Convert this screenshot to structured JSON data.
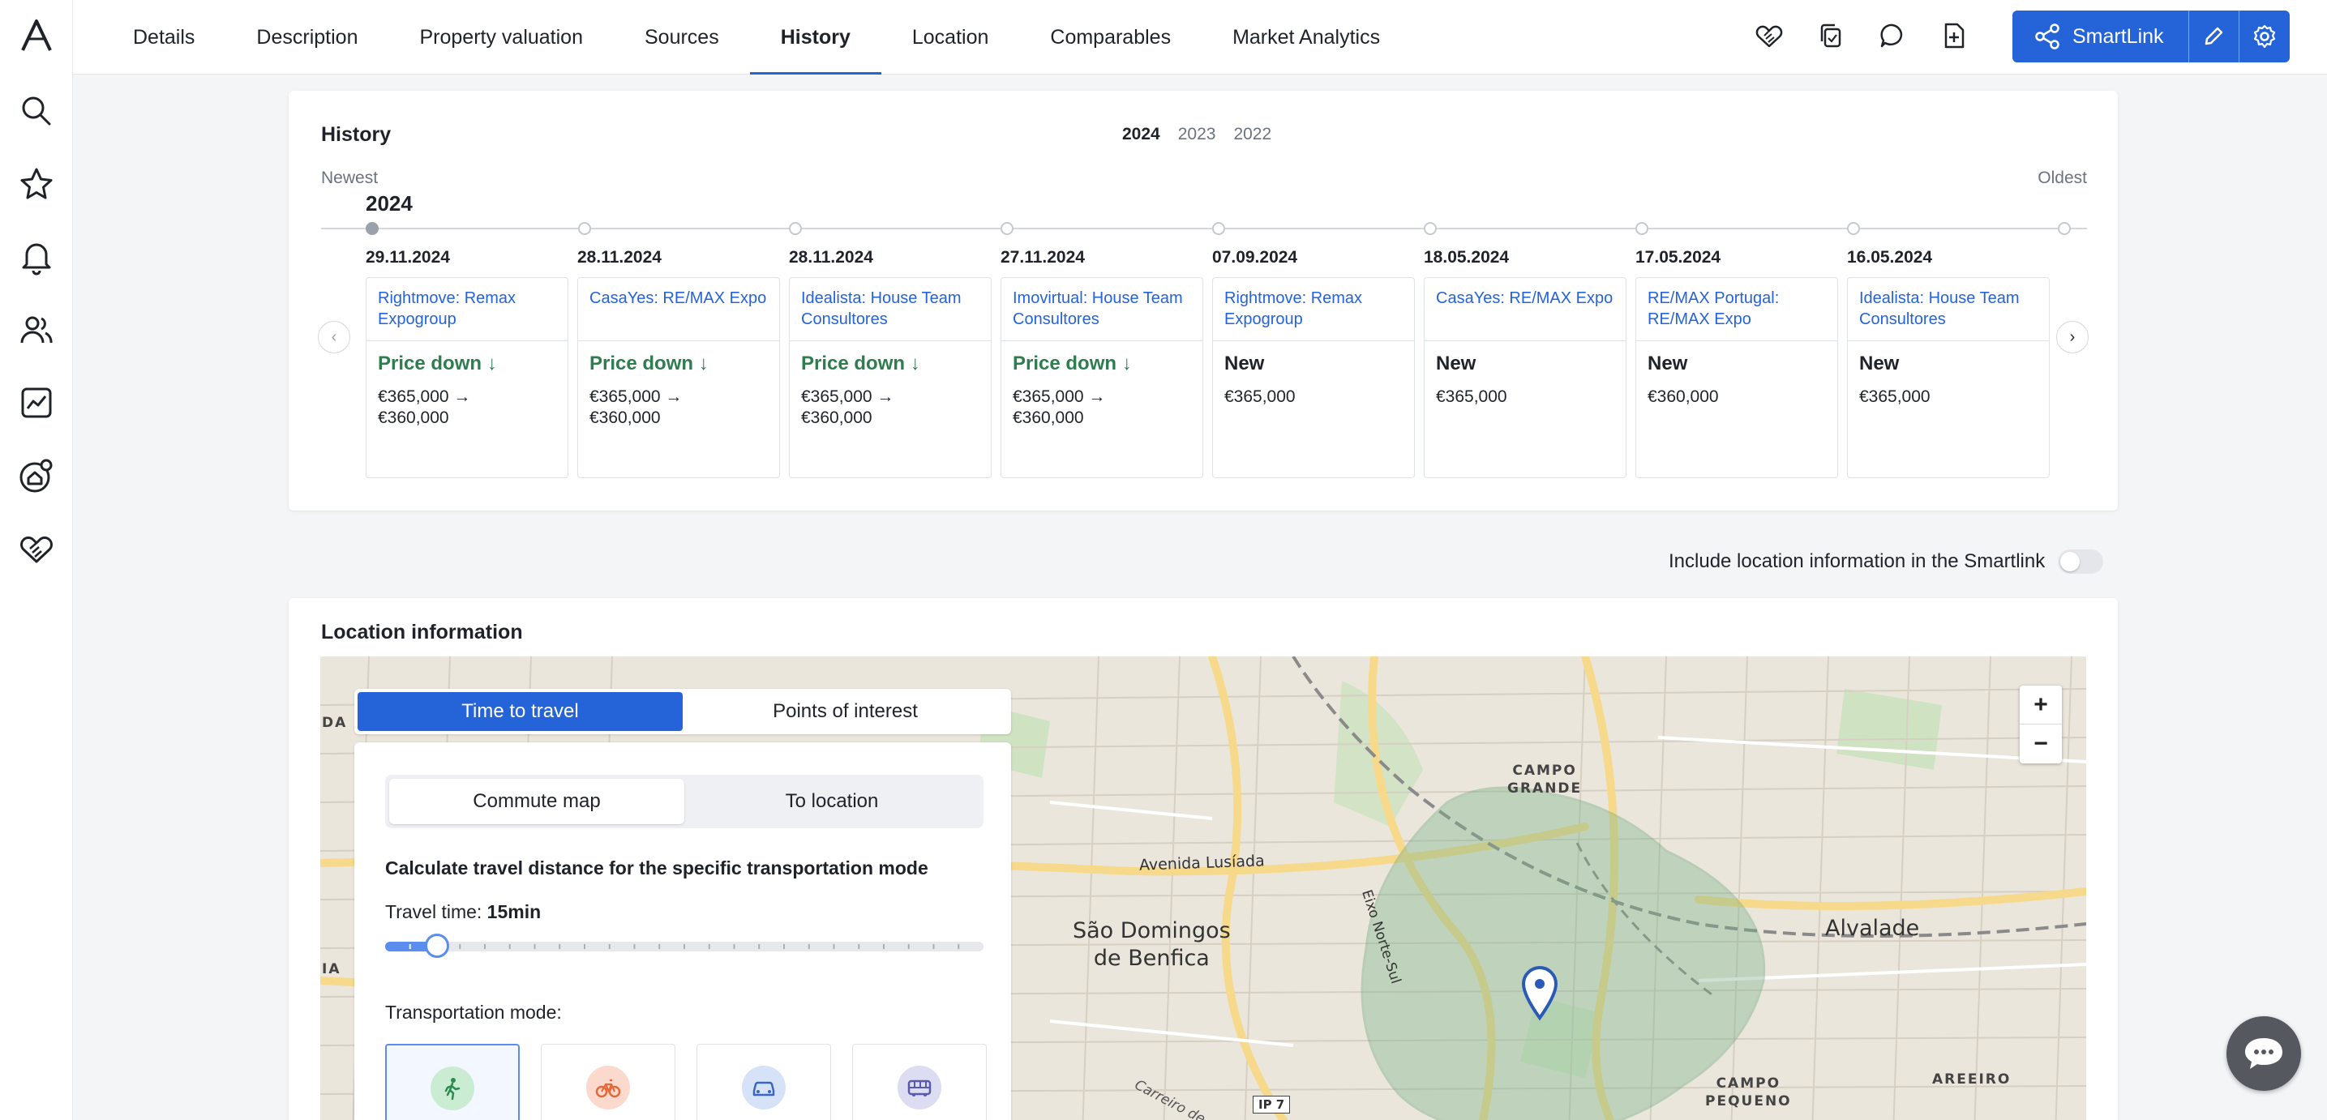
{
  "nav": {
    "tabs": [
      {
        "label": "Details"
      },
      {
        "label": "Description"
      },
      {
        "label": "Property valuation"
      },
      {
        "label": "Sources"
      },
      {
        "label": "History",
        "active": true
      },
      {
        "label": "Location"
      },
      {
        "label": "Comparables"
      },
      {
        "label": "Market Analytics"
      }
    ],
    "smartlink_label": "SmartLink"
  },
  "sidebar": {
    "items": [
      "search-icon",
      "star-icon",
      "bell-icon",
      "users-icon",
      "chart-icon",
      "home-search-icon",
      "handshake-icon"
    ]
  },
  "history": {
    "title": "History",
    "years": [
      "2024",
      "2023",
      "2022"
    ],
    "selected_year": "2024",
    "newest_label": "Newest",
    "oldest_label": "Oldest",
    "timeline_year": "2024",
    "events": [
      {
        "date": "29.11.2024",
        "source": "Rightmove: Remax Expogroup",
        "status": "Price down",
        "direction": "down",
        "price_line1": "€365,000 →",
        "price_line2": "€360,000"
      },
      {
        "date": "28.11.2024",
        "source": "CasaYes: RE/MAX Expo",
        "status": "Price down",
        "direction": "down",
        "price_line1": "€365,000 →",
        "price_line2": "€360,000"
      },
      {
        "date": "28.11.2024",
        "source": "Idealista: House Team Consultores",
        "status": "Price down",
        "direction": "down",
        "price_line1": "€365,000 →",
        "price_line2": "€360,000"
      },
      {
        "date": "27.11.2024",
        "source": "Imovirtual: House Team Consultores",
        "status": "Price down",
        "direction": "down",
        "price_line1": "€365,000 →",
        "price_line2": "€360,000"
      },
      {
        "date": "07.09.2024",
        "source": "Rightmove: Remax Expogroup",
        "status": "New",
        "direction": "new",
        "price_line1": "€365,000",
        "price_line2": ""
      },
      {
        "date": "18.05.2024",
        "source": "CasaYes: RE/MAX Expo",
        "status": "New",
        "direction": "new",
        "price_line1": "€365,000",
        "price_line2": ""
      },
      {
        "date": "17.05.2024",
        "source": "RE/MAX Portugal: RE/MAX Expo",
        "status": "New",
        "direction": "new",
        "price_line1": "€360,000",
        "price_line2": ""
      },
      {
        "date": "16.05.2024",
        "source": "Idealista: House Team Consultores",
        "status": "New",
        "direction": "new",
        "price_line1": "€365,000",
        "price_line2": ""
      }
    ]
  },
  "smartlink_toggle": {
    "label": "Include location information in the Smartlink",
    "checked": false
  },
  "location": {
    "title": "Location information",
    "travel_tabs": [
      "Time to travel",
      "Points of interest"
    ],
    "sub_tabs": [
      "Commute map",
      "To location"
    ],
    "calc_label": "Calculate travel distance for the specific transportation mode",
    "travel_time_label": "Travel time:",
    "travel_time_value": "15min",
    "travel_time_fraction": 0.087,
    "transport_label": "Transportation mode:",
    "modes": [
      {
        "icon": "walking-icon",
        "color": "#c9ecd3",
        "selected": true
      },
      {
        "icon": "bicycle-icon",
        "color": "#fbd9cc",
        "selected": false
      },
      {
        "icon": "car-icon",
        "color": "#d6e2f8",
        "selected": false
      },
      {
        "icon": "bus-icon",
        "color": "#dcdcf2",
        "selected": false
      }
    ],
    "map_labels": {
      "campo_grande": "CAMPO\nGRANDE",
      "avenida_lusiada": "Avenida Lusíada",
      "sao_domingos": "São Domingos\nde Benfica",
      "eixo": "Eixo Norte-Sul",
      "alvalade": "Alvalade",
      "campo_pequeno": "CAMPO\nPEQUENO",
      "areeiro": "AREEIRO",
      "ip7": "IP 7",
      "carreiro": "Carreiro de",
      "edge_da": "DA",
      "edge_ia": "IA"
    }
  }
}
